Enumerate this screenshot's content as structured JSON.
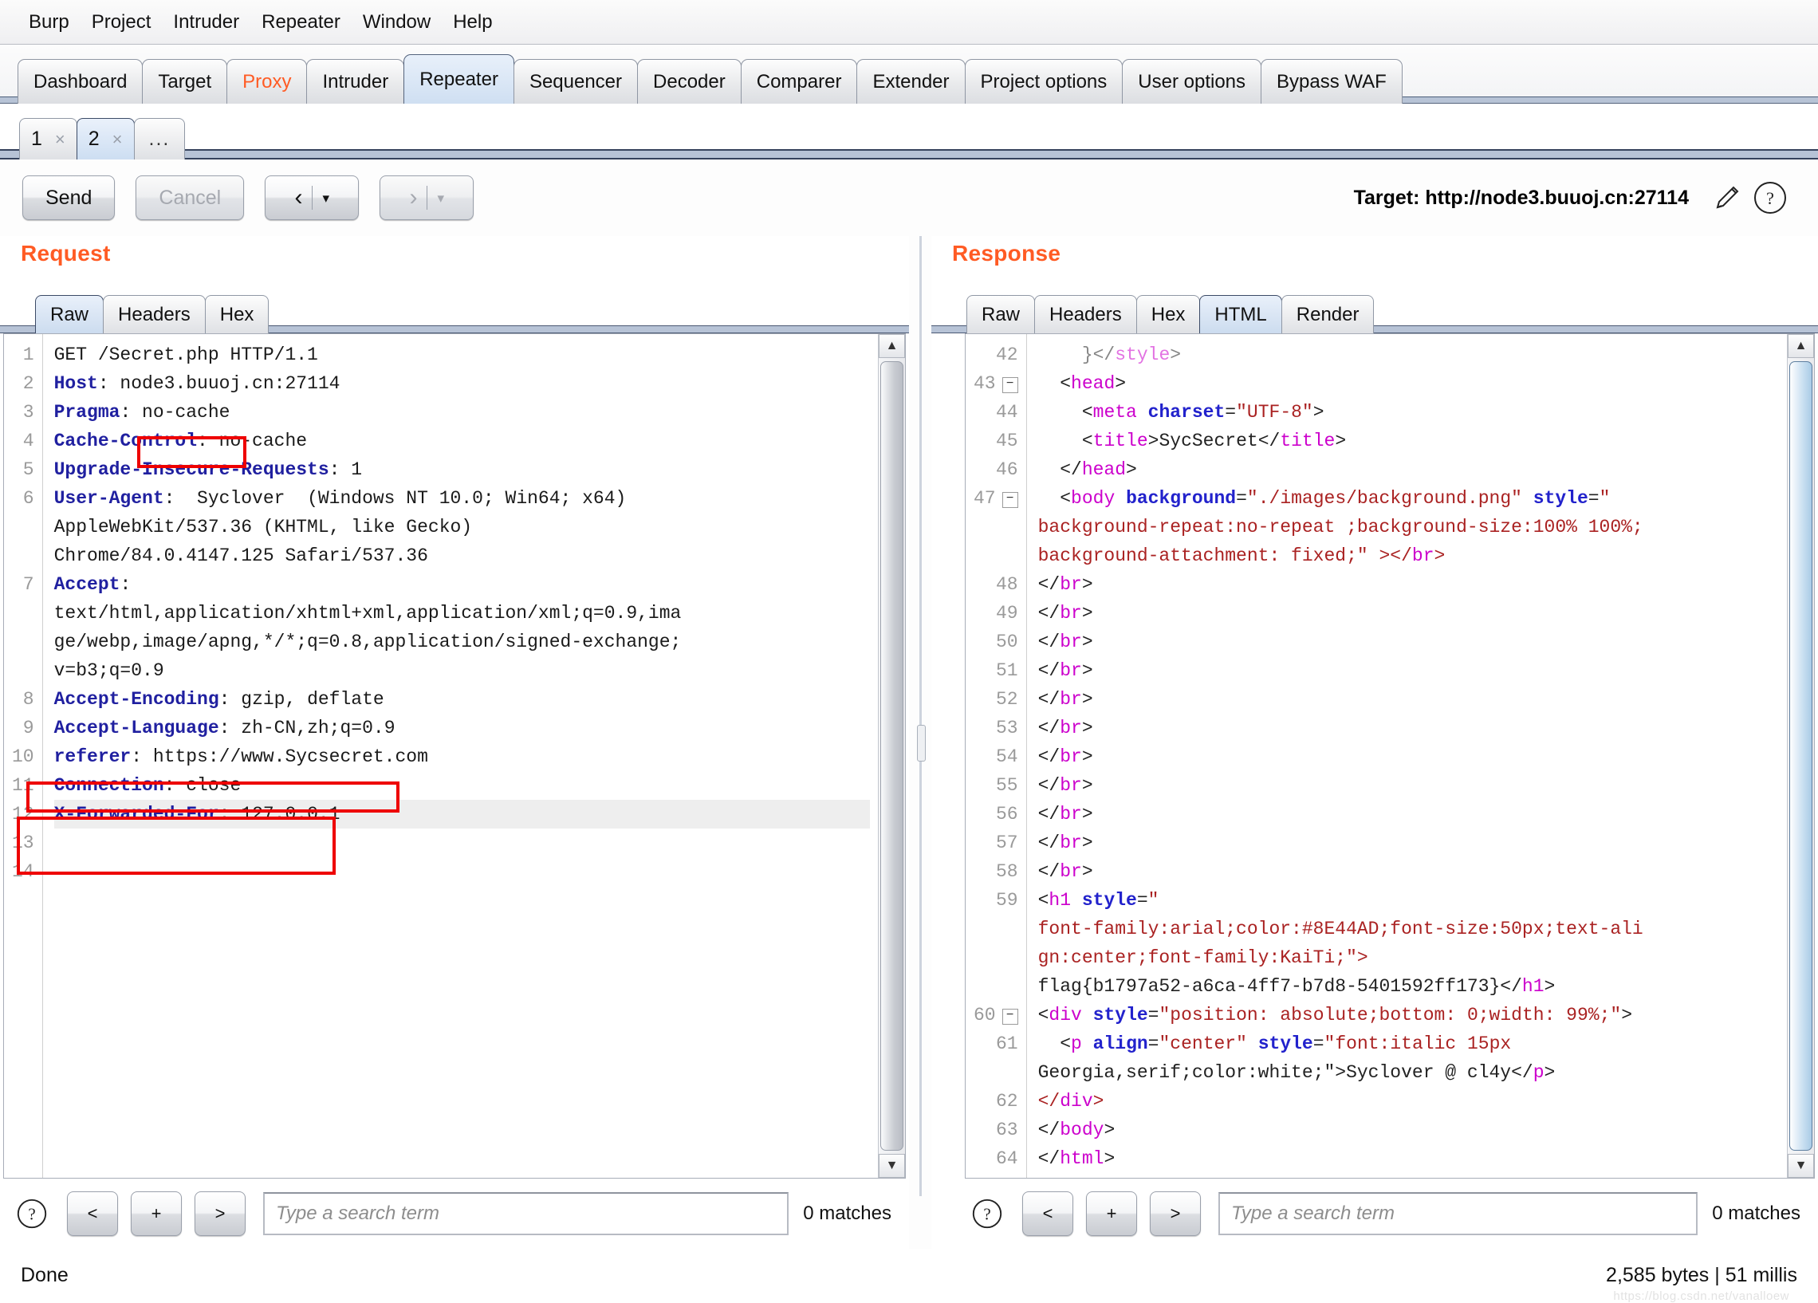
{
  "menubar": {
    "items": [
      "Burp",
      "Project",
      "Intruder",
      "Repeater",
      "Window",
      "Help"
    ]
  },
  "main_tabs": [
    {
      "label": "Dashboard",
      "active": false,
      "accent": false
    },
    {
      "label": "Target",
      "active": false,
      "accent": false
    },
    {
      "label": "Proxy",
      "active": false,
      "accent": true
    },
    {
      "label": "Intruder",
      "active": false,
      "accent": false
    },
    {
      "label": "Repeater",
      "active": true,
      "accent": false
    },
    {
      "label": "Sequencer",
      "active": false,
      "accent": false
    },
    {
      "label": "Decoder",
      "active": false,
      "accent": false
    },
    {
      "label": "Comparer",
      "active": false,
      "accent": false
    },
    {
      "label": "Extender",
      "active": false,
      "accent": false
    },
    {
      "label": "Project options",
      "active": false,
      "accent": false
    },
    {
      "label": "User options",
      "active": false,
      "accent": false
    },
    {
      "label": "Bypass WAF",
      "active": false,
      "accent": false
    }
  ],
  "repeater_tabs": [
    {
      "label": "1",
      "close": "×",
      "active": false
    },
    {
      "label": "2",
      "close": "×",
      "active": true
    },
    {
      "label": "...",
      "close": "",
      "active": false
    }
  ],
  "actionbar": {
    "send_label": "Send",
    "cancel_label": "Cancel",
    "back_chevron": "‹",
    "forward_chevron": "›",
    "caret": "▾",
    "target_label": "Target: http://node3.buuoj.cn:27114",
    "edit_icon": "pencil-icon",
    "help_icon": "question-icon"
  },
  "request": {
    "title": "Request",
    "tabs": [
      {
        "label": "Raw",
        "active": true
      },
      {
        "label": "Headers",
        "active": false
      },
      {
        "label": "Hex",
        "active": false
      }
    ],
    "gutter": [
      "1",
      "2",
      "3",
      "4",
      "5",
      "6",
      "",
      "",
      "7",
      "",
      "",
      "",
      "8",
      "9",
      "10",
      "11",
      "12",
      "13",
      "14"
    ],
    "lines": [
      {
        "n": "1",
        "type": "plain",
        "text": "GET /Secret.php HTTP/1.1"
      },
      {
        "n": "2",
        "type": "header",
        "name": "Host",
        "value": " node3.buuoj.cn:27114"
      },
      {
        "n": "3",
        "type": "header",
        "name": "Pragma",
        "value": " no-cache"
      },
      {
        "n": "4",
        "type": "header",
        "name": "Cache-Control",
        "value": " no-cache"
      },
      {
        "n": "5",
        "type": "header",
        "name": "Upgrade-Insecure-Requests",
        "value": " 1"
      },
      {
        "n": "6",
        "type": "header",
        "name": "User-Agent",
        "value": "  Syclover  (Windows NT 10.0; Win64; x64)"
      },
      {
        "n": "",
        "type": "plain",
        "text": "AppleWebKit/537.36 (KHTML, like Gecko)"
      },
      {
        "n": "",
        "type": "plain",
        "text": "Chrome/84.0.4147.125 Safari/537.36"
      },
      {
        "n": "7",
        "type": "header",
        "name": "Accept",
        "value": ""
      },
      {
        "n": "",
        "type": "plain",
        "text": "text/html,application/xhtml+xml,application/xml;q=0.9,ima"
      },
      {
        "n": "",
        "type": "plain",
        "text": "ge/webp,image/apng,*/*;q=0.8,application/signed-exchange;"
      },
      {
        "n": "",
        "type": "plain",
        "text": "v=b3;q=0.9"
      },
      {
        "n": "8",
        "type": "header",
        "name": "Accept-Encoding",
        "value": " gzip, deflate"
      },
      {
        "n": "9",
        "type": "header",
        "name": "Accept-Language",
        "value": " zh-CN,zh;q=0.9"
      },
      {
        "n": "10",
        "type": "header",
        "name": "referer",
        "value": " https://www.Sycsecret.com"
      },
      {
        "n": "11",
        "type": "header",
        "name": "Connection",
        "value": " close"
      },
      {
        "n": "12",
        "type": "header",
        "name": "X-Forwarded-For",
        "value": " 127.0.0.1",
        "highlight": true
      },
      {
        "n": "13",
        "type": "plain",
        "text": ""
      },
      {
        "n": "14",
        "type": "plain",
        "text": ""
      }
    ],
    "search": {
      "help_icon": "question-icon",
      "prev_label": "<",
      "add_label": "+",
      "next_label": ">",
      "placeholder": "Type a search term",
      "value": "",
      "matches": "0 matches"
    }
  },
  "response": {
    "title": "Response",
    "tabs": [
      {
        "label": "Raw",
        "active": false
      },
      {
        "label": "Headers",
        "active": false
      },
      {
        "label": "Hex",
        "active": false
      },
      {
        "label": "HTML",
        "active": true
      },
      {
        "label": "Render",
        "active": false
      }
    ],
    "lines": [
      {
        "n": "42",
        "fold": false,
        "clipped": true,
        "html": "    }</style>"
      },
      {
        "n": "43",
        "fold": true,
        "html": "  <head>"
      },
      {
        "n": "44",
        "fold": false,
        "html": "    <meta charset=\"UTF-8\">"
      },
      {
        "n": "45",
        "fold": false,
        "html": "    <title>SycSecret</title>"
      },
      {
        "n": "46",
        "fold": false,
        "html": "  </head>"
      },
      {
        "n": "47",
        "fold": true,
        "html": "  <body background=\"./images/background.png\" style=\""
      },
      {
        "n": "",
        "fold": false,
        "html": "background-repeat:no-repeat ;background-size:100% 100%;"
      },
      {
        "n": "",
        "fold": false,
        "html": "background-attachment: fixed;\" ></br>"
      },
      {
        "n": "48",
        "fold": false,
        "html": "</br>"
      },
      {
        "n": "49",
        "fold": false,
        "html": "</br>"
      },
      {
        "n": "50",
        "fold": false,
        "html": "</br>"
      },
      {
        "n": "51",
        "fold": false,
        "html": "</br>"
      },
      {
        "n": "52",
        "fold": false,
        "html": "</br>"
      },
      {
        "n": "53",
        "fold": false,
        "html": "</br>"
      },
      {
        "n": "54",
        "fold": false,
        "html": "</br>"
      },
      {
        "n": "55",
        "fold": false,
        "html": "</br>"
      },
      {
        "n": "56",
        "fold": false,
        "html": "</br>"
      },
      {
        "n": "57",
        "fold": false,
        "html": "</br>"
      },
      {
        "n": "58",
        "fold": false,
        "html": "</br>"
      },
      {
        "n": "59",
        "fold": false,
        "html": "<h1 style=\""
      },
      {
        "n": "",
        "fold": false,
        "html": "font-family:arial;color:#8E44AD;font-size:50px;text-ali"
      },
      {
        "n": "",
        "fold": false,
        "html": "gn:center;font-family:KaiTi;\">"
      },
      {
        "n": "",
        "fold": false,
        "html": "flag{b1797a52-a6ca-4ff7-b7d8-5401592ff173}</h1>"
      },
      {
        "n": "60",
        "fold": true,
        "html": "<div style=\"position: absolute;bottom: 0;width: 99%;\">"
      },
      {
        "n": "61",
        "fold": false,
        "html": "  <p align=\"center\" style=\"font:italic 15px"
      },
      {
        "n": "",
        "fold": false,
        "html": "Georgia,serif;color:white;\">Syclover @ cl4y</p>"
      },
      {
        "n": "62",
        "fold": false,
        "html": "</div>"
      },
      {
        "n": "63",
        "fold": false,
        "html": "</body>"
      },
      {
        "n": "64",
        "fold": false,
        "html": "</html>"
      }
    ],
    "flag": "flag{b1797a52-a6ca-4ff7-b7d8-5401592ff173}",
    "search": {
      "help_icon": "question-icon",
      "prev_label": "<",
      "add_label": "+",
      "next_label": ">",
      "placeholder": "Type a search term",
      "value": "",
      "matches": "0 matches"
    }
  },
  "statusbar": {
    "left": "Done",
    "right": "2,585 bytes | 51 millis",
    "watermark": "https://blog.csdn.net/vanalloew"
  },
  "colors": {
    "accent": "#ff5b24",
    "tab_active": "#cfdff2",
    "annotation": "#ee0000",
    "header_name": "#2020a0",
    "tag": "#cc00cc",
    "attr": "#2222cc",
    "string": "#aa2222"
  }
}
